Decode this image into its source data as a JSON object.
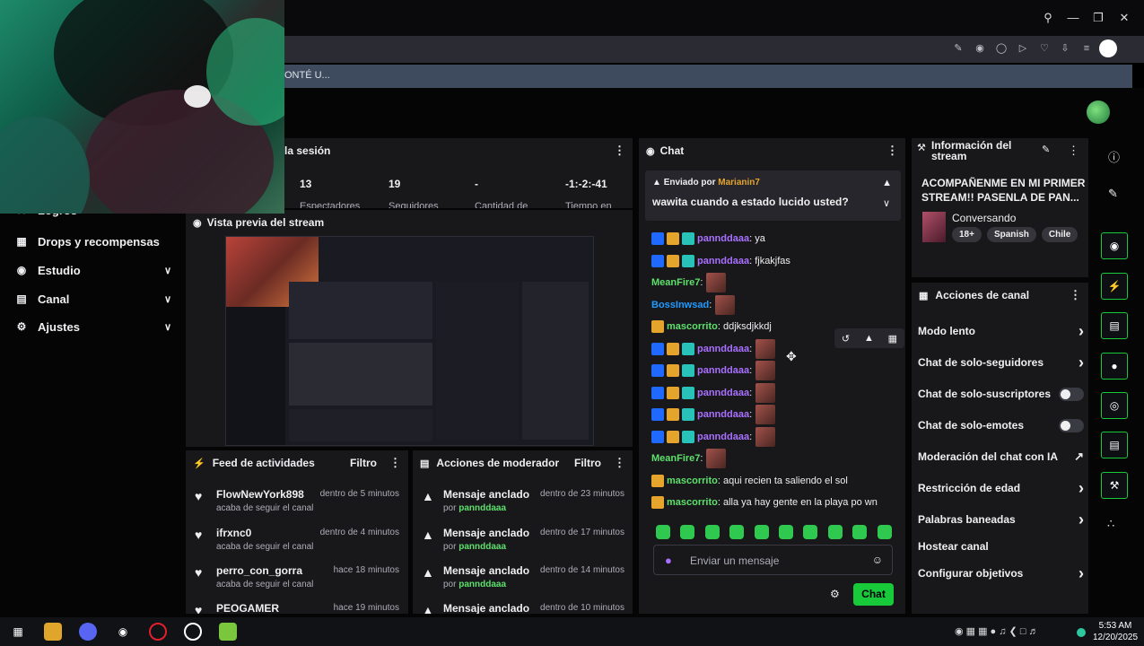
{
  "browser": {
    "banner_text": "ONTÉ U...",
    "title_icons": [
      "search-icon",
      "minimize-icon",
      "maximize-icon",
      "close-icon"
    ],
    "toolbar_icons": [
      "edit-icon",
      "camera-icon",
      "shield-icon",
      "play-icon",
      "heart-icon",
      "download-icon",
      "menu-icon",
      "profile-icon"
    ]
  },
  "left_nav": {
    "partial_item": "Logros",
    "items": [
      {
        "label": "Drops y recompensas",
        "icon": "drops-icon",
        "chevron": false
      },
      {
        "label": "Estudio",
        "icon": "studio-icon",
        "chevron": true
      },
      {
        "label": "Canal",
        "icon": "channel-icon",
        "chevron": true
      },
      {
        "label": "Ajustes",
        "icon": "gear-icon",
        "chevron": true
      }
    ]
  },
  "session": {
    "title": "la sesión",
    "stats": [
      {
        "value": "13",
        "label": "Espectadores"
      },
      {
        "value": "19",
        "label": "Seguidores"
      },
      {
        "value": "-",
        "label": "Cantidad de"
      },
      {
        "value": "-1:-2:-41",
        "label": "Tiempo en"
      }
    ]
  },
  "preview": {
    "title": "Vista previa del stream"
  },
  "feed": {
    "title": "Feed de actividades",
    "filter": "Filtro",
    "items": [
      {
        "name": "FlowNewYork898",
        "time": "dentro de 5 minutos",
        "sub": "acaba de seguir el canal"
      },
      {
        "name": "ifrxnc0",
        "time": "dentro de 4 minutos",
        "sub": "acaba de seguir el canal"
      },
      {
        "name": "perro_con_gorra",
        "time": "hace 18 minutos",
        "sub": "acaba de seguir el canal"
      },
      {
        "name": "PEOGAMER",
        "time": "hace 19 minutos",
        "sub": ""
      }
    ]
  },
  "mod": {
    "title": "Acciones de moderador",
    "filter": "Filtro",
    "items": [
      {
        "name": "Mensaje anclado",
        "time": "dentro de 23 minutos",
        "by": "por",
        "user": "pannddaaa"
      },
      {
        "name": "Mensaje anclado",
        "time": "dentro de 17 minutos",
        "by": "por",
        "user": "pannddaaa"
      },
      {
        "name": "Mensaje anclado",
        "time": "dentro de 14 minutos",
        "by": "por",
        "user": "pannddaaa"
      },
      {
        "name": "Mensaje anclado",
        "time": "dentro de 10 minutos",
        "by": "",
        "user": ""
      }
    ]
  },
  "chat": {
    "title": "Chat",
    "pinned_prefix": "Enviado por",
    "pinned_user": "Marianin7",
    "pinned_message": "wawita cuando a estado lucido usted?",
    "messages": [
      {
        "user": "pannddaaa",
        "color": "#a970ff",
        "badges": [
          "blue",
          "gold",
          "teal"
        ],
        "text": ": ya",
        "emote": false
      },
      {
        "user": "pannddaaa",
        "color": "#a970ff",
        "badges": [
          "blue",
          "gold",
          "teal"
        ],
        "text": ": fjkakjfas",
        "emote": false
      },
      {
        "user": "MeanFire7",
        "color": "#5ee06c",
        "badges": [],
        "text": ":",
        "emote": true
      },
      {
        "user": "BossInwsad",
        "color": "#1f9bff",
        "badges": [],
        "text": ":",
        "emote": true
      },
      {
        "user": "mascorrito",
        "color": "#5ee06c",
        "badges": [
          "gold"
        ],
        "text": ": ddjksdjkkdj",
        "emote": false
      },
      {
        "user": "pannddaaa",
        "color": "#a970ff",
        "badges": [
          "blue",
          "gold",
          "teal"
        ],
        "text": ":",
        "emote": true
      },
      {
        "user": "pannddaaa",
        "color": "#a970ff",
        "badges": [
          "blue",
          "gold",
          "teal"
        ],
        "text": ":",
        "emote": true
      },
      {
        "user": "pannddaaa",
        "color": "#a970ff",
        "badges": [
          "blue",
          "gold",
          "teal"
        ],
        "text": ":",
        "emote": true
      },
      {
        "user": "pannddaaa",
        "color": "#a970ff",
        "badges": [
          "blue",
          "gold",
          "teal"
        ],
        "text": ":",
        "emote": true
      },
      {
        "user": "pannddaaa",
        "color": "#a970ff",
        "badges": [
          "blue",
          "gold",
          "teal"
        ],
        "text": ":",
        "emote": true
      },
      {
        "user": "MeanFire7",
        "color": "#5ee06c",
        "badges": [],
        "text": ":",
        "emote": true
      },
      {
        "user": "mascorrito",
        "color": "#5ee06c",
        "badges": [
          "gold"
        ],
        "text": ": aqui recien ta saliendo el sol",
        "emote": false
      },
      {
        "user": "mascorrito",
        "color": "#5ee06c",
        "badges": [
          "gold"
        ],
        "text": ": alla ya hay gente en la playa po wn",
        "emote": false
      }
    ],
    "input_placeholder": "Enviar un mensaje",
    "send_label": "Chat"
  },
  "stream_info": {
    "title": "Información del stream",
    "stream_title": "ACOMPAÑENME EN MI PRIMER STREAM!! PASENLA DE PAN...",
    "category": "Conversando",
    "tags": [
      "18+",
      "Spanish",
      "Chile"
    ]
  },
  "actions": {
    "title": "Acciones de canal",
    "items": [
      {
        "label": "Modo lento",
        "control": "chevron"
      },
      {
        "label": "Chat de solo-seguidores",
        "control": "chevron"
      },
      {
        "label": "Chat de solo-suscriptores",
        "control": "toggle"
      },
      {
        "label": "Chat de solo-emotes",
        "control": "toggle"
      },
      {
        "label": "Moderación del chat con IA",
        "control": "external"
      },
      {
        "label": "Restricción de edad",
        "control": "chevron"
      },
      {
        "label": "Palabras baneadas",
        "control": "chevron"
      },
      {
        "label": "Hostear canal",
        "control": "none"
      },
      {
        "label": "Configurar objetivos",
        "control": "chevron"
      }
    ]
  },
  "taskbar": {
    "time": "5:53 AM",
    "date": "12/20/2025"
  },
  "colors": {
    "accent": "#18c93a",
    "panel": "#18181b",
    "purple": "#a970ff",
    "green": "#5ee06c"
  }
}
